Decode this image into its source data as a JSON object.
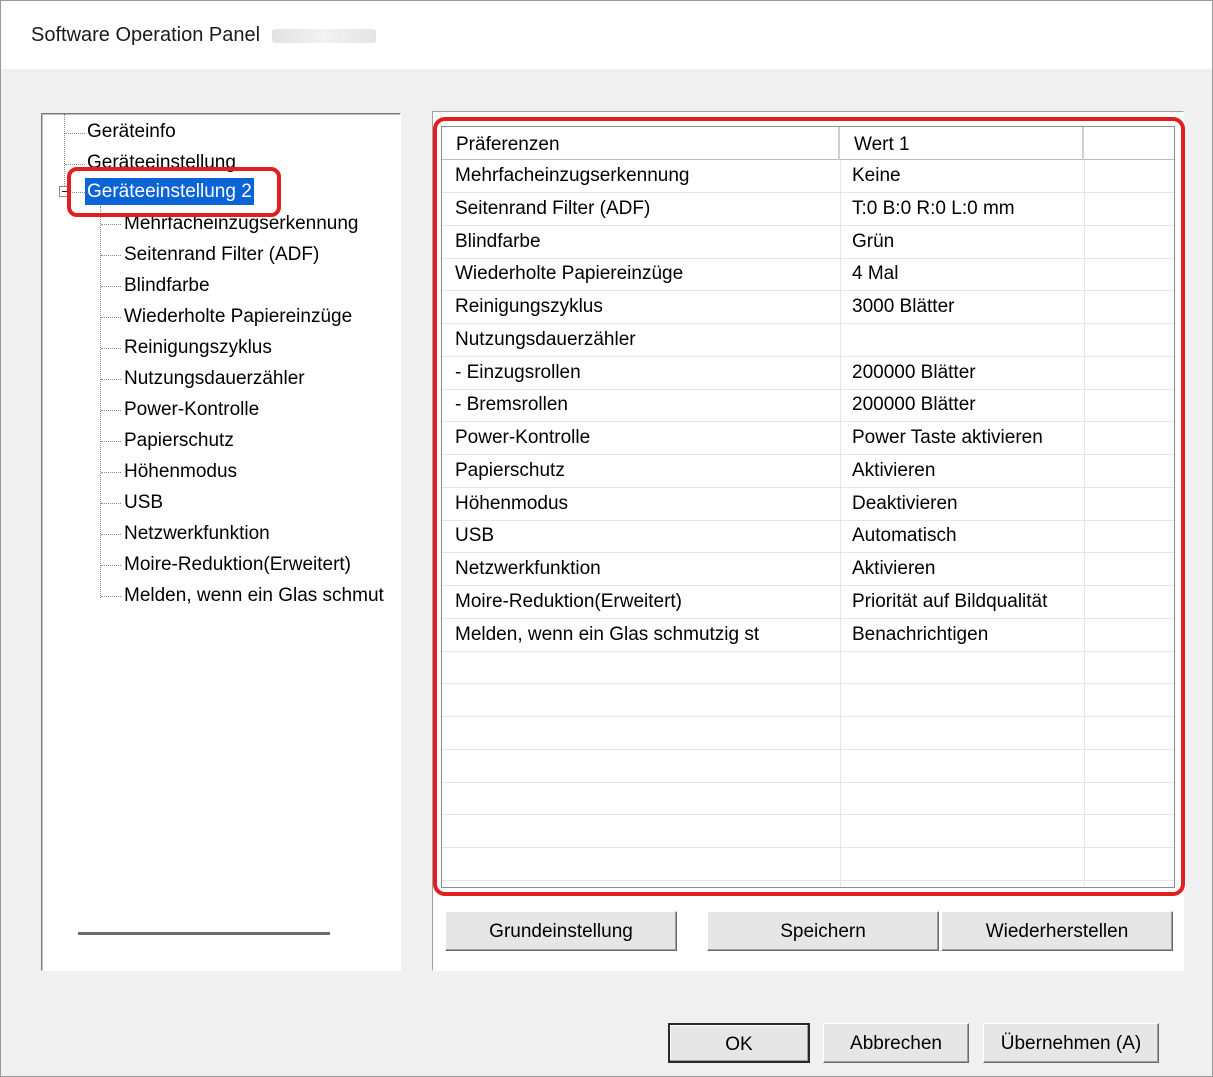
{
  "window": {
    "title": "Software Operation Panel"
  },
  "tree": {
    "items": [
      {
        "label": "Geräteinfo"
      },
      {
        "label": "Geräteeinstellung"
      },
      {
        "label": "Geräteeinstellung 2",
        "selected": true
      },
      {
        "label": "Mehrfacheinzugserkennung"
      },
      {
        "label": "Seitenrand Filter (ADF)"
      },
      {
        "label": "Blindfarbe"
      },
      {
        "label": "Wiederholte Papiereinzüge"
      },
      {
        "label": "Reinigungszyklus"
      },
      {
        "label": "Nutzungsdauerzähler"
      },
      {
        "label": "Power-Kontrolle"
      },
      {
        "label": "Papierschutz"
      },
      {
        "label": "Höhenmodus"
      },
      {
        "label": "USB"
      },
      {
        "label": "Netzwerkfunktion"
      },
      {
        "label": "Moire-Reduktion(Erweitert)"
      },
      {
        "label": "Melden, wenn ein Glas schmut"
      }
    ]
  },
  "grid": {
    "headers": [
      "Präferenzen",
      "Wert 1",
      ""
    ],
    "rows": [
      [
        "Mehrfacheinzugserkennung",
        "Keine"
      ],
      [
        "Seitenrand Filter (ADF)",
        "T:0  B:0  R:0  L:0 mm"
      ],
      [
        "Blindfarbe",
        "Grün"
      ],
      [
        "Wiederholte Papiereinzüge",
        "4 Mal"
      ],
      [
        "Reinigungszyklus",
        "3000 Blätter"
      ],
      [
        "Nutzungsdauerzähler",
        ""
      ],
      [
        " - Einzugsrollen",
        "200000 Blätter"
      ],
      [
        " - Bremsrollen",
        "200000 Blätter"
      ],
      [
        "Power-Kontrolle",
        "Power Taste aktivieren"
      ],
      [
        "Papierschutz",
        "Aktivieren"
      ],
      [
        "Höhenmodus",
        "Deaktivieren"
      ],
      [
        "USB",
        "Automatisch"
      ],
      [
        "Netzwerkfunktion",
        "Aktivieren"
      ],
      [
        "Moire-Reduktion(Erweitert)",
        "Priorität auf Bildqualität"
      ],
      [
        "Melden, wenn ein Glas schmutzig st",
        "Benachrichtigen"
      ]
    ]
  },
  "panel_buttons": {
    "default": "Grundeinstellung",
    "save": "Speichern",
    "restore": "Wiederherstellen"
  },
  "dialog_buttons": {
    "ok": "OK",
    "cancel": "Abbrechen",
    "apply": "Übernehmen (A)"
  },
  "colors": {
    "highlight": "#e01f1f",
    "selection": "#0a64d6"
  }
}
